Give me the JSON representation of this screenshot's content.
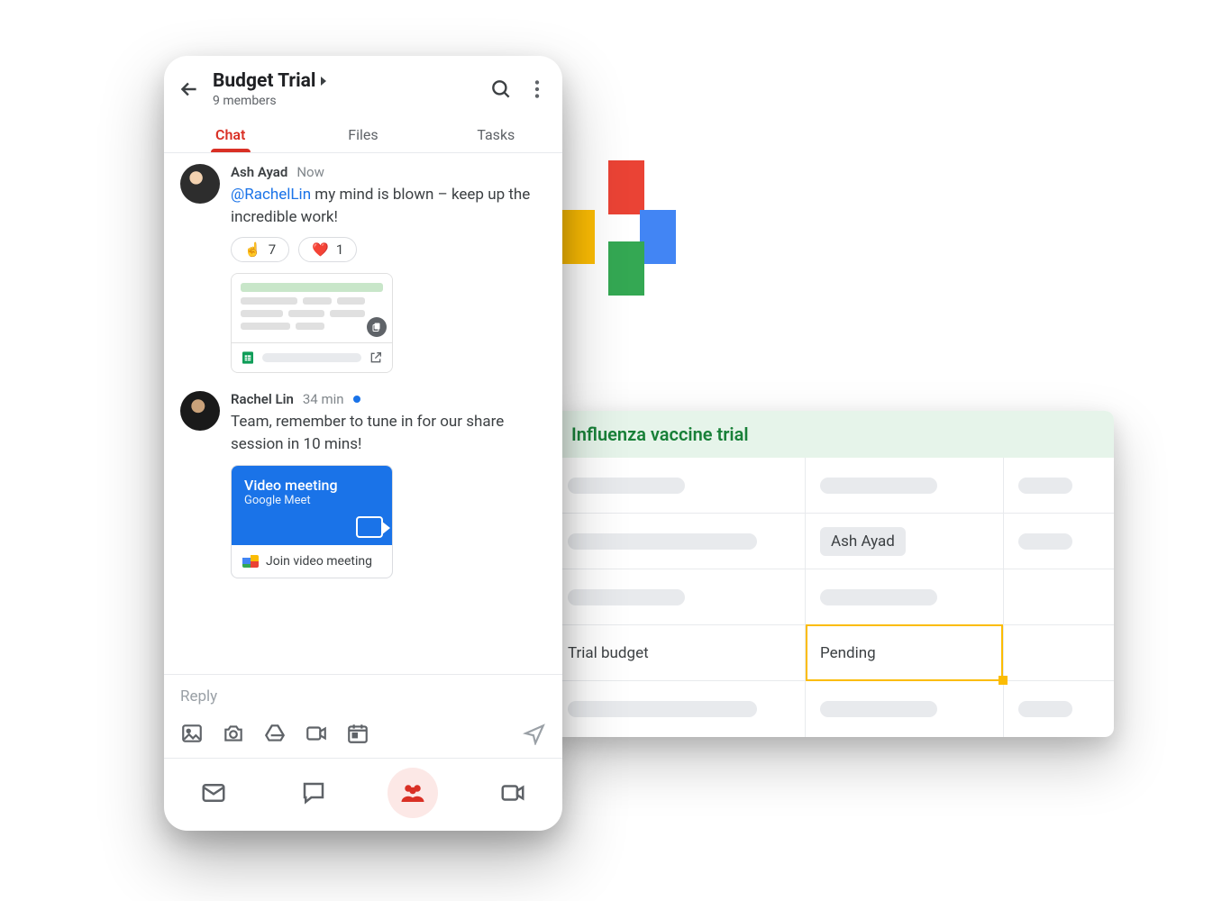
{
  "colors": {
    "accent_red": "#d93025",
    "blue": "#1a73e8",
    "green": "#188038",
    "selection": "#fbbc04"
  },
  "header": {
    "title": "Budget Trial",
    "subtitle": "9 members"
  },
  "tabs": {
    "chat": "Chat",
    "files": "Files",
    "tasks": "Tasks"
  },
  "messages": [
    {
      "author": "Ash Ayad",
      "time": "Now",
      "mention": "@RachelLin",
      "text_after_mention": " my mind is blown – keep up the incredible work!",
      "reactions": [
        {
          "emoji": "☝️",
          "count": "7"
        },
        {
          "emoji": "❤️",
          "count": "1"
        }
      ],
      "has_sheet_attachment": true
    },
    {
      "author": "Rachel Lin",
      "time": "34 min",
      "unread": true,
      "text": "Team, remember to tune in for our share session in 10 mins!",
      "meet": {
        "title": "Video meeting",
        "subtitle": "Google Meet",
        "join_label": "Join video meeting"
      }
    }
  ],
  "reply": {
    "placeholder": "Reply"
  },
  "spreadsheet": {
    "title": "Influenza vaccine trial",
    "rows": [
      {
        "c1": null,
        "c2": null,
        "c3": null
      },
      {
        "c1": null,
        "c2_chip": "Ash Ayad",
        "c3": null
      },
      {
        "c1": null,
        "c2": null,
        "c3": null
      },
      {
        "c1_text": "Trial budget",
        "c2_text": "Pending",
        "selected": true,
        "c3": null
      },
      {
        "c1": null,
        "c2": null,
        "c3": null
      }
    ]
  }
}
